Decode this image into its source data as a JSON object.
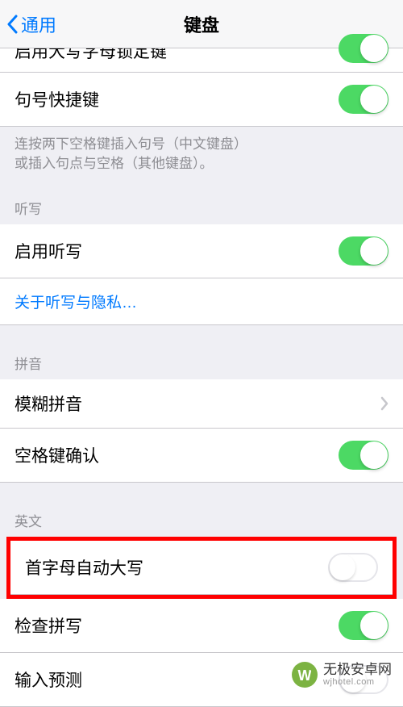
{
  "nav": {
    "back": "通用",
    "title": "键盘"
  },
  "rows": {
    "caps_lock": "启用大写字母锁定键",
    "period_shortcut": "句号快捷键"
  },
  "footer": {
    "period_help_1": "连按两下空格键插入句号（中文键盘）",
    "period_help_2": "或插入句点与空格（其他键盘）。"
  },
  "sections": {
    "dictation": "听写",
    "pinyin": "拼音",
    "english": "英文"
  },
  "dictation": {
    "enable": "启用听写",
    "about": "关于听写与隐私…"
  },
  "pinyin": {
    "fuzzy": "模糊拼音",
    "space_confirm": "空格键确认"
  },
  "english": {
    "auto_cap": "首字母自动大写",
    "spell_check": "检查拼写",
    "predictive": "输入预测"
  },
  "watermark": {
    "title": "无极安卓网",
    "sub": "wjhotel.com"
  }
}
